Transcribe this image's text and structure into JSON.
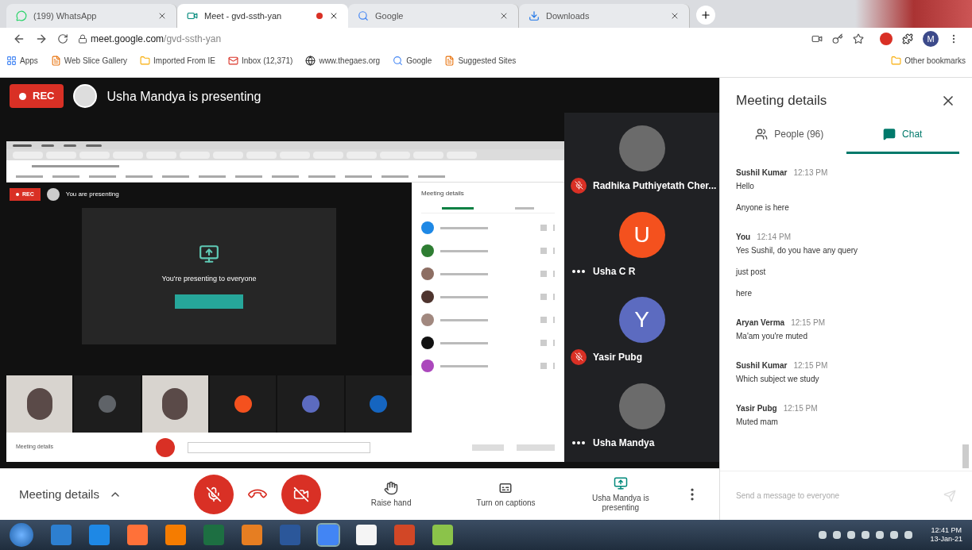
{
  "browser": {
    "tabs": [
      {
        "title": "(199) WhatsApp",
        "selected": false,
        "kind": "whatsapp",
        "recording": false
      },
      {
        "title": "Meet - gvd-ssth-yan",
        "selected": true,
        "kind": "meet",
        "recording": true
      },
      {
        "title": "Google",
        "selected": false,
        "kind": "google",
        "recording": false
      },
      {
        "title": "Downloads",
        "selected": false,
        "kind": "download",
        "recording": false
      }
    ],
    "url": {
      "host": "meet.google.com",
      "path": "/gvd-ssth-yan"
    },
    "profile_initial": "M",
    "bookmarks": [
      {
        "label": "Apps",
        "kind": "apps"
      },
      {
        "label": "Web Slice Gallery",
        "kind": "page"
      },
      {
        "label": "Imported From IE",
        "kind": "folder"
      },
      {
        "label": "Inbox (12,371)",
        "kind": "mail"
      },
      {
        "label": "www.thegaes.org",
        "kind": "globe"
      },
      {
        "label": "Google",
        "kind": "google"
      },
      {
        "label": "Suggested Sites",
        "kind": "page"
      }
    ],
    "other_bookmarks": "Other bookmarks"
  },
  "stage": {
    "rec_label": "REC",
    "presenter_title": "Usha Mandya is presenting",
    "shared_screen": {
      "rec_label": "REC",
      "status": "You are presenting",
      "message": "You're presenting to everyone",
      "panel_title": "Meeting details",
      "bottom_label": "Meeting details"
    },
    "tiles": [
      {
        "name": "Radhika Puthiyetath Cher...",
        "kind": "photo",
        "muted": true
      },
      {
        "name": "Usha C R",
        "kind": "letter",
        "initial": "U",
        "color": "#f4511e",
        "muted": false
      },
      {
        "name": "Yasir Pubg",
        "kind": "letter",
        "initial": "Y",
        "color": "#5c6bc0",
        "muted": true
      },
      {
        "name": "Usha Mandya",
        "kind": "photo",
        "muted": false
      }
    ]
  },
  "toolbar": {
    "details_label": "Meeting details",
    "mic_on": false,
    "camera_on": false,
    "actions": [
      {
        "label": "Raise hand",
        "kind": "hand"
      },
      {
        "label": "Turn on captions",
        "kind": "captions"
      },
      {
        "label": "Usha Mandya is presenting",
        "kind": "presenting"
      }
    ]
  },
  "chat_panel": {
    "title": "Meeting details",
    "tabs": [
      {
        "label": "People (96)",
        "kind": "people",
        "selected": false
      },
      {
        "label": "Chat",
        "kind": "chat",
        "selected": true
      }
    ],
    "messages": [
      {
        "sender": "Sushil Kumar",
        "time": "12:13 PM",
        "lines": [
          "Hello",
          "Anyone is here"
        ]
      },
      {
        "sender": "You",
        "time": "12:14 PM",
        "lines": [
          "Yes Sushil, do you have any query",
          "just post",
          "here"
        ]
      },
      {
        "sender": "Aryan Verma",
        "time": "12:15 PM",
        "lines": [
          "Ma'am you're muted"
        ]
      },
      {
        "sender": "Sushil Kumar",
        "time": "12:15 PM",
        "lines": [
          "Which subject we study"
        ]
      },
      {
        "sender": "Yasir Pubg",
        "time": "12:15 PM",
        "lines": [
          "Muted mam"
        ]
      }
    ],
    "input_placeholder": "Send a message to everyone"
  },
  "taskbar": {
    "time": "12:41 PM",
    "date": "13-Jan-21"
  }
}
